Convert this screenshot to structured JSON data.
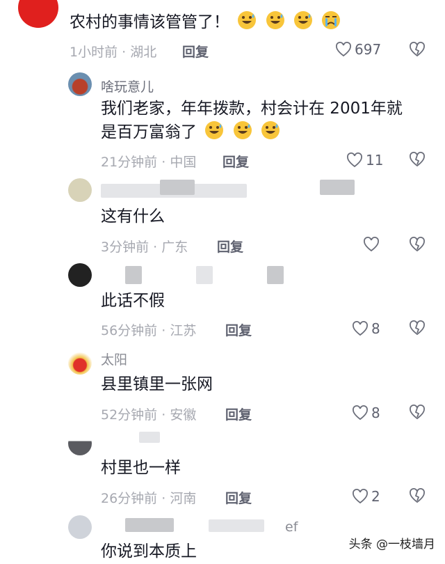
{
  "comments": [
    {
      "name": "",
      "text": "农村的事情该管管了！",
      "time": "1小时前",
      "location": "湖北",
      "reply": "回复",
      "likes": "697",
      "emojis": [
        "grin-sweat-icon",
        "grin-sweat-icon",
        "grin-sweat-icon",
        "crying-icon"
      ]
    },
    {
      "name": "啥玩意儿",
      "text_line1": "我们老家，年年拨款，村会计在 2001年就",
      "text_line2": "是百万富翁了",
      "time": "21分钟前",
      "location": "中国",
      "reply": "回复",
      "likes": "11"
    },
    {
      "name": "",
      "text": "这有什么",
      "time": "3分钟前",
      "location": "广东",
      "reply": "回复",
      "likes": ""
    },
    {
      "name": "",
      "text": "此话不假",
      "time": "56分钟前",
      "location": "江苏",
      "reply": "回复",
      "likes": "8"
    },
    {
      "name": "太阳",
      "text": "县里镇里一张网",
      "time": "52分钟前",
      "location": "安徽",
      "reply": "回复",
      "likes": "8"
    },
    {
      "name": "",
      "text": "村里也一样",
      "time": "26分钟前",
      "location": "河南",
      "reply": "回复",
      "likes": "2"
    },
    {
      "name": "ef",
      "text": "你说到本质上",
      "time": "",
      "location": "",
      "reply": "",
      "likes": ""
    }
  ],
  "watermark": "头条 @一枝墙月",
  "colors": {
    "text": "#161823",
    "meta": "#a6a8b0",
    "name": "#6b6e7a"
  }
}
